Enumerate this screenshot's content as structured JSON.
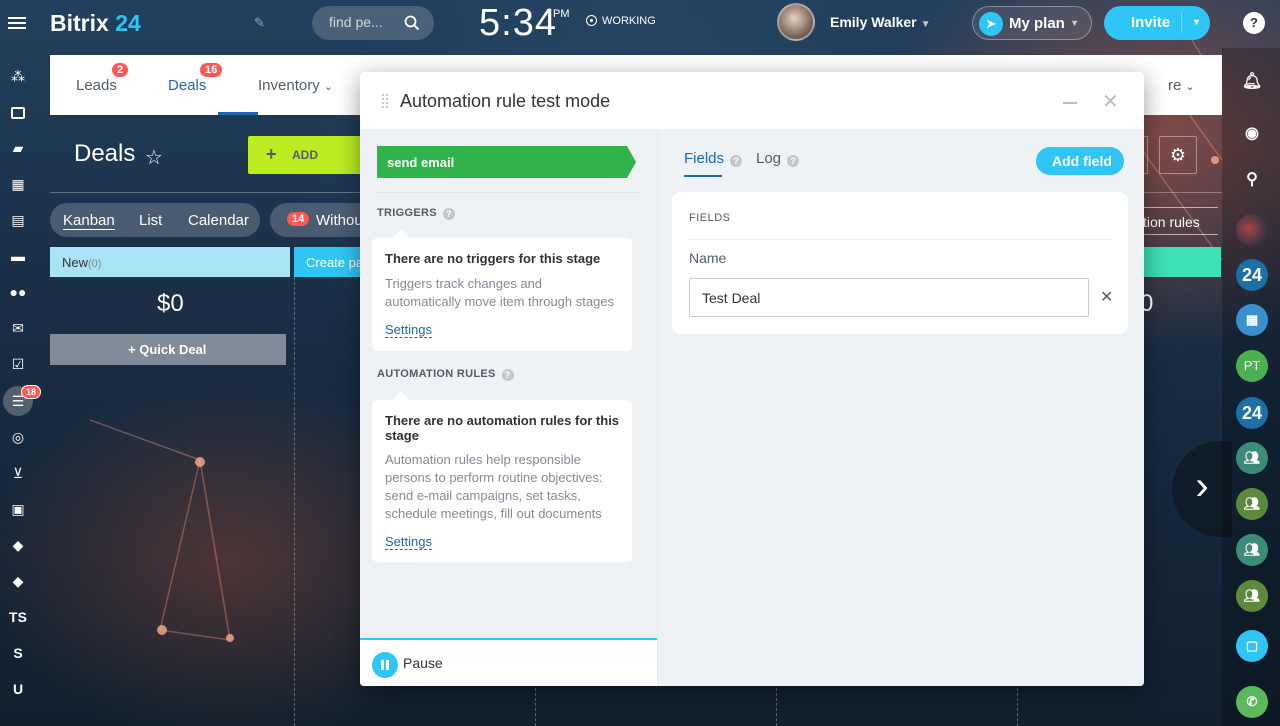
{
  "header": {
    "logo_main": "Bitrix",
    "logo_num": "24",
    "search_placeholder": "find pe...",
    "clock_time": "5:34",
    "clock_ampm": "PM",
    "status": "WORKING",
    "user_name": "Emily Walker",
    "my_plan_label": "My plan",
    "invite_label": "Invite",
    "help_glyph": "?"
  },
  "left_sidebar": {
    "badge": "18",
    "text_items": [
      "TS",
      "S",
      "U"
    ]
  },
  "right_sidebar": {
    "items": [
      "24",
      "24",
      "PT"
    ]
  },
  "crm": {
    "tabs": [
      {
        "label": "Leads",
        "badge": "2"
      },
      {
        "label": "Deals",
        "badge": "16"
      },
      {
        "label": "Inventory"
      }
    ],
    "more_fragment": "re",
    "page_title": "Deals",
    "add_label": "ADD",
    "views": [
      "Kanban",
      "List",
      "Calendar"
    ],
    "without_badge": "14",
    "without_label": "Withou",
    "rules_label": "tion rules",
    "columns": [
      {
        "label": "New",
        "count": "(0)",
        "sum": "$0"
      },
      {
        "label": "Create pa"
      }
    ],
    "right_sum_fragment": "0",
    "quick_deal_label": "+ Quick Deal"
  },
  "modal": {
    "title": "Automation rule test mode",
    "stage_label": "send email",
    "triggers": {
      "section_title": "TRIGGERS",
      "card_title": "There are no triggers for this stage",
      "card_desc": "Triggers track changes and automatically move item through stages",
      "settings_link": "Settings"
    },
    "automation": {
      "section_title": "AUTOMATION RULES",
      "card_title": "There are no automation rules for this stage",
      "card_desc": "Automation rules help responsible persons to perform routine objectives: send e-mail campaigns, set tasks, schedule meetings, fill out documents",
      "settings_link": "Settings"
    },
    "pause_label": "Pause",
    "right_tabs": [
      {
        "label": "Fields"
      },
      {
        "label": "Log"
      }
    ],
    "add_field_label": "Add field",
    "fields_section_title": "FIELDS",
    "name_label": "Name",
    "name_value": "Test Deal"
  }
}
